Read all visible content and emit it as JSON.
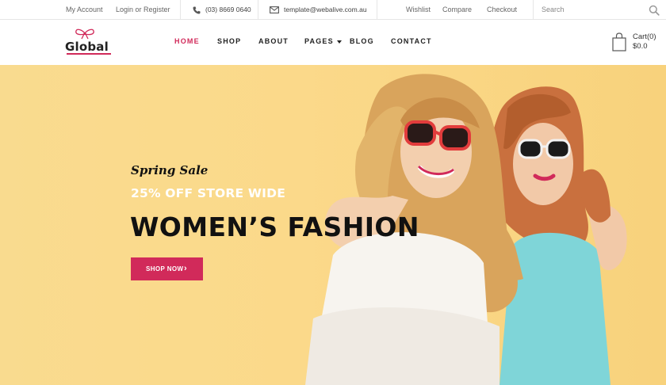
{
  "topbar": {
    "my_account": "My Account",
    "login": "Login or Register",
    "phone": "(03) 8669 0640",
    "email": "template@webalive.com.au",
    "wishlist": "Wishlist",
    "compare": "Compare",
    "checkout": "Checkout",
    "search_placeholder": "Search"
  },
  "header": {
    "logo_text": "Global",
    "nav": [
      "HOME",
      "SHOP",
      "ABOUT",
      "PAGES",
      "BLOG",
      "CONTACT"
    ],
    "cart_label": "Cart(0)",
    "cart_total": "$0.0"
  },
  "hero": {
    "promo": "Spring Sale",
    "discount": "25% OFF STORE WIDE",
    "headline": "WOMEN’S FASHION",
    "cta_label": "SHOP NOW",
    "cta_arrow": "›"
  },
  "colors": {
    "accent": "#d12a5a",
    "hero_bg": "#f9db8f"
  },
  "icons": [
    "phone-icon",
    "email-icon",
    "search-icon",
    "bow-icon",
    "cart-icon",
    "chevron-right-icon"
  ]
}
